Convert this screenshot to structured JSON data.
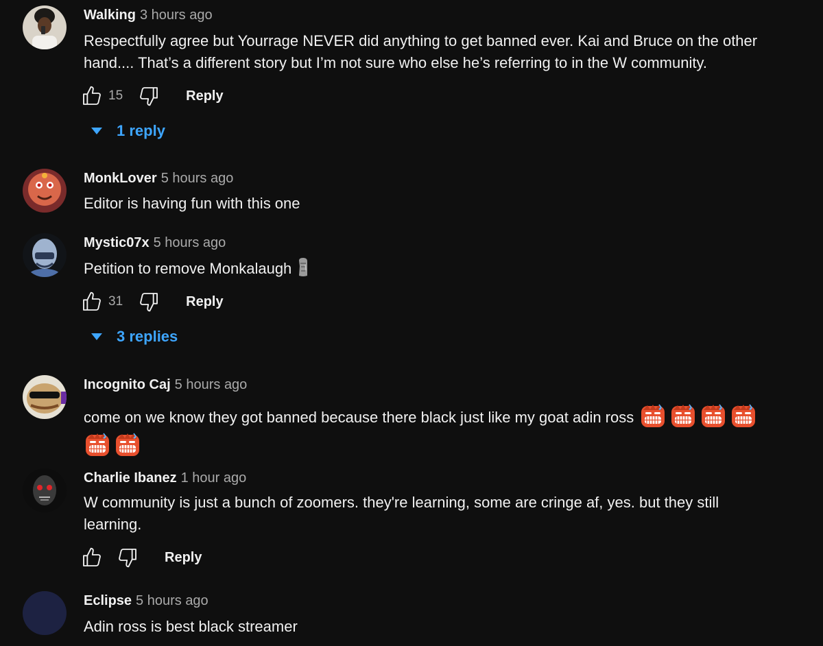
{
  "comments": [
    {
      "author": "Walking",
      "time": "3 hours ago",
      "text": "Respectfully agree but Yourrage NEVER did anything to get banned ever. Kai and Bruce on the other hand.... That’s a different story but I’m not sure who else he’s referring to in the W community.",
      "likes": "15",
      "reply_label": "Reply",
      "replies_label": "1 reply"
    },
    {
      "author": "MonkLover",
      "time": "5 hours ago",
      "text": "Editor is having fun with this one"
    },
    {
      "author": "Mystic07x",
      "time": "5 hours ago",
      "text": "Petition to remove Monkalaugh",
      "text_emoji": "moai-emoji",
      "likes": "31",
      "reply_label": "Reply",
      "replies_label": "3 replies"
    },
    {
      "author": "Incognito Caj",
      "time": "5 hours ago",
      "text": "come on we know they got banned because there black just like my goat adin ross",
      "text_emoji": "face-with-symbols-emoji",
      "emoji_count": 6
    },
    {
      "author": "Charlie Ibanez",
      "time": "1 hour ago",
      "text": "W community is just a bunch of zoomers. they're learning, some are cringe af, yes. but they still learning.",
      "reply_label": "Reply"
    },
    {
      "author": "Eclipse",
      "time": "5 hours ago",
      "text": "Adin ross is best black streamer"
    }
  ],
  "colors": {
    "background": "#0f0f0f",
    "text": "#f1f1f1",
    "secondary": "#aaaaaa",
    "link": "#3ea6ff",
    "emoji": "#e8502e"
  },
  "icons": [
    "thumbs-up-icon",
    "thumbs-down-icon",
    "caret-down-icon"
  ]
}
